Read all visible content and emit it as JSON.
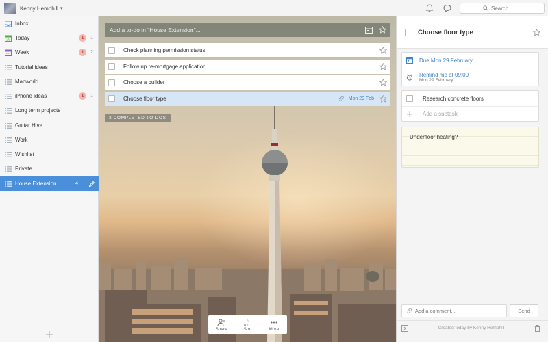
{
  "user": {
    "name": "Kenny Hemphill",
    "caret": "▾"
  },
  "header": {
    "icons": [
      "bell-icon",
      "chat-bubble-icon"
    ],
    "search_placeholder": "Search..."
  },
  "sidebar": {
    "items": [
      {
        "label": "Inbox",
        "icon": "inbox-icon",
        "badge": "",
        "count": ""
      },
      {
        "label": "Today",
        "icon": "calendar-today-icon",
        "badge": "1",
        "count": "1"
      },
      {
        "label": "Week",
        "icon": "calendar-week-icon",
        "badge": "1",
        "count": "2"
      },
      {
        "label": "Tutorial ideas",
        "icon": "list-icon",
        "badge": "",
        "count": ""
      },
      {
        "label": "Macworld",
        "icon": "list-icon",
        "badge": "",
        "count": ""
      },
      {
        "label": "iPhone ideas",
        "icon": "list-icon",
        "badge": "1",
        "count": "1"
      },
      {
        "label": "Long term projects",
        "icon": "list-icon",
        "badge": "",
        "count": ""
      },
      {
        "label": "Guitar Hive",
        "icon": "list-icon",
        "badge": "",
        "count": ""
      },
      {
        "label": "Work",
        "icon": "list-icon",
        "badge": "",
        "count": ""
      },
      {
        "label": "Wishlist",
        "icon": "list-icon",
        "badge": "",
        "count": ""
      },
      {
        "label": "Private",
        "icon": "list-icon",
        "badge": "",
        "count": ""
      },
      {
        "label": "House Extension",
        "icon": "list-icon",
        "badge": "",
        "count": "4",
        "active": true
      }
    ]
  },
  "main": {
    "add_placeholder": "Add a to-do in \"House Extension\"...",
    "tasks": [
      {
        "title": "Check planning permission status",
        "due": ""
      },
      {
        "title": "Follow up re-mortgage application",
        "due": ""
      },
      {
        "title": "Choose a builder",
        "due": ""
      },
      {
        "title": "Choose floor type",
        "due": "Mon 29 Feb",
        "selected": true,
        "has_attachment": true
      }
    ],
    "completed_label": "3 COMPLETED TO-DOS",
    "toolbar": {
      "share": "Share",
      "sort": "Sort",
      "more": "More"
    }
  },
  "detail": {
    "title": "Choose floor type",
    "due": "Due Mon 29 February",
    "remind_title": "Remind me at 09:00",
    "remind_date": "Mon 29 February",
    "subtasks": [
      "Research concrete floors"
    ],
    "add_subtask_placeholder": "Add a subtask",
    "note": "Underfloor heating?",
    "comment_placeholder": "Add a comment...",
    "send_label": "Send",
    "created": "Created today by Kenny Hemphill"
  },
  "colors": {
    "accent": "#4a8fd9",
    "due_blue": "#3d84c8",
    "badge_bg": "#f0b7b3",
    "badge_text": "#c0392b"
  }
}
